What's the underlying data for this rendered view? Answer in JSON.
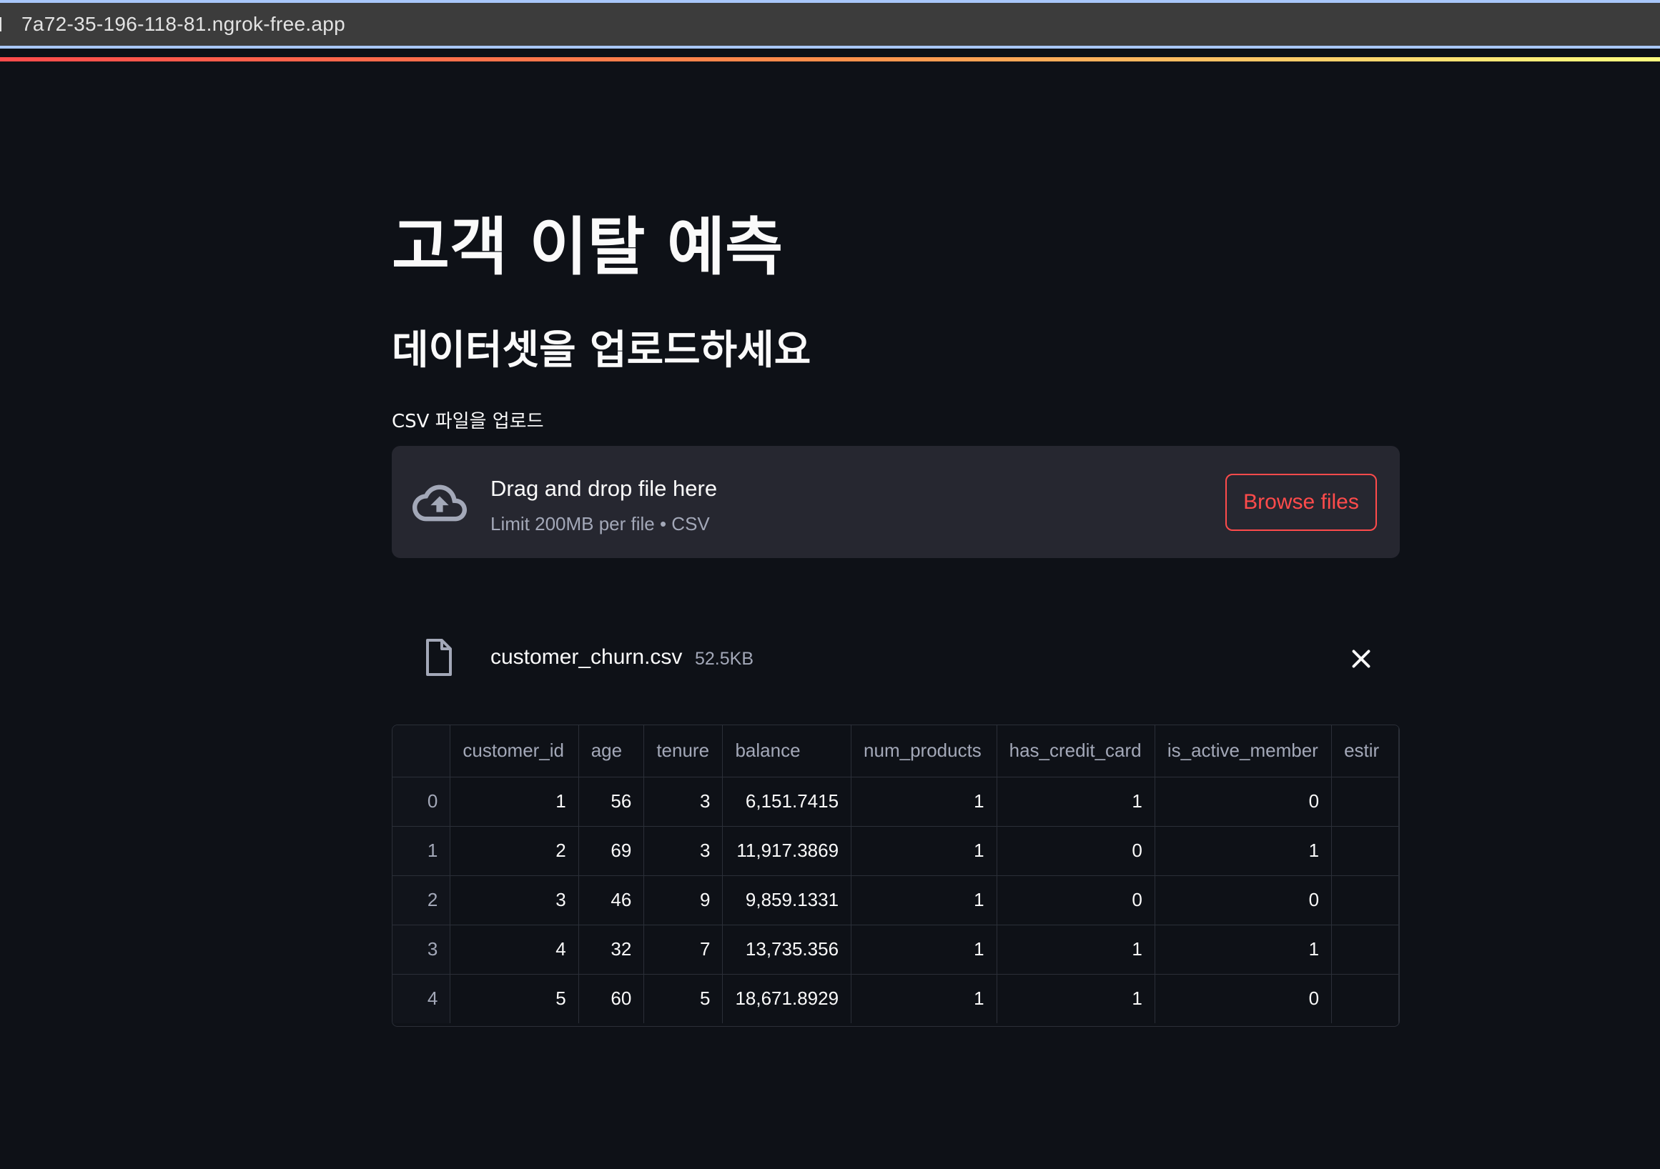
{
  "browser": {
    "url": "7a72-35-196-118-81.ngrok-free.app"
  },
  "page": {
    "title": "고객 이탈 예측",
    "subheader": "데이터셋을 업로드하세요"
  },
  "uploader": {
    "label": "CSV 파일을 업로드",
    "drop_text": "Drag and drop file here",
    "limit_text": "Limit 200MB per file • CSV",
    "browse_label": "Browse files",
    "upload_icon": "cloud-upload-icon"
  },
  "uploaded_file": {
    "name": "customer_churn.csv",
    "size": "52.5KB",
    "file_icon": "file-icon",
    "remove_icon": "close-icon"
  },
  "table": {
    "columns": [
      "",
      "customer_id",
      "age",
      "tenure",
      "balance",
      "num_products",
      "has_credit_card",
      "is_active_member",
      "estir"
    ],
    "rows": [
      [
        "0",
        "1",
        "56",
        "3",
        "6,151.7415",
        "1",
        "1",
        "0",
        ""
      ],
      [
        "1",
        "2",
        "69",
        "3",
        "11,917.3869",
        "1",
        "0",
        "1",
        ""
      ],
      [
        "2",
        "3",
        "46",
        "9",
        "9,859.1331",
        "1",
        "0",
        "0",
        ""
      ],
      [
        "3",
        "4",
        "32",
        "7",
        "13,735.356",
        "1",
        "1",
        "1",
        ""
      ],
      [
        "4",
        "5",
        "60",
        "5",
        "18,671.8929",
        "1",
        "1",
        "0",
        ""
      ]
    ]
  },
  "colors": {
    "background": "#0e1117",
    "accent": "#ff4b4b",
    "dropzone": "#262730",
    "muted_text": "#a3a8b8"
  }
}
